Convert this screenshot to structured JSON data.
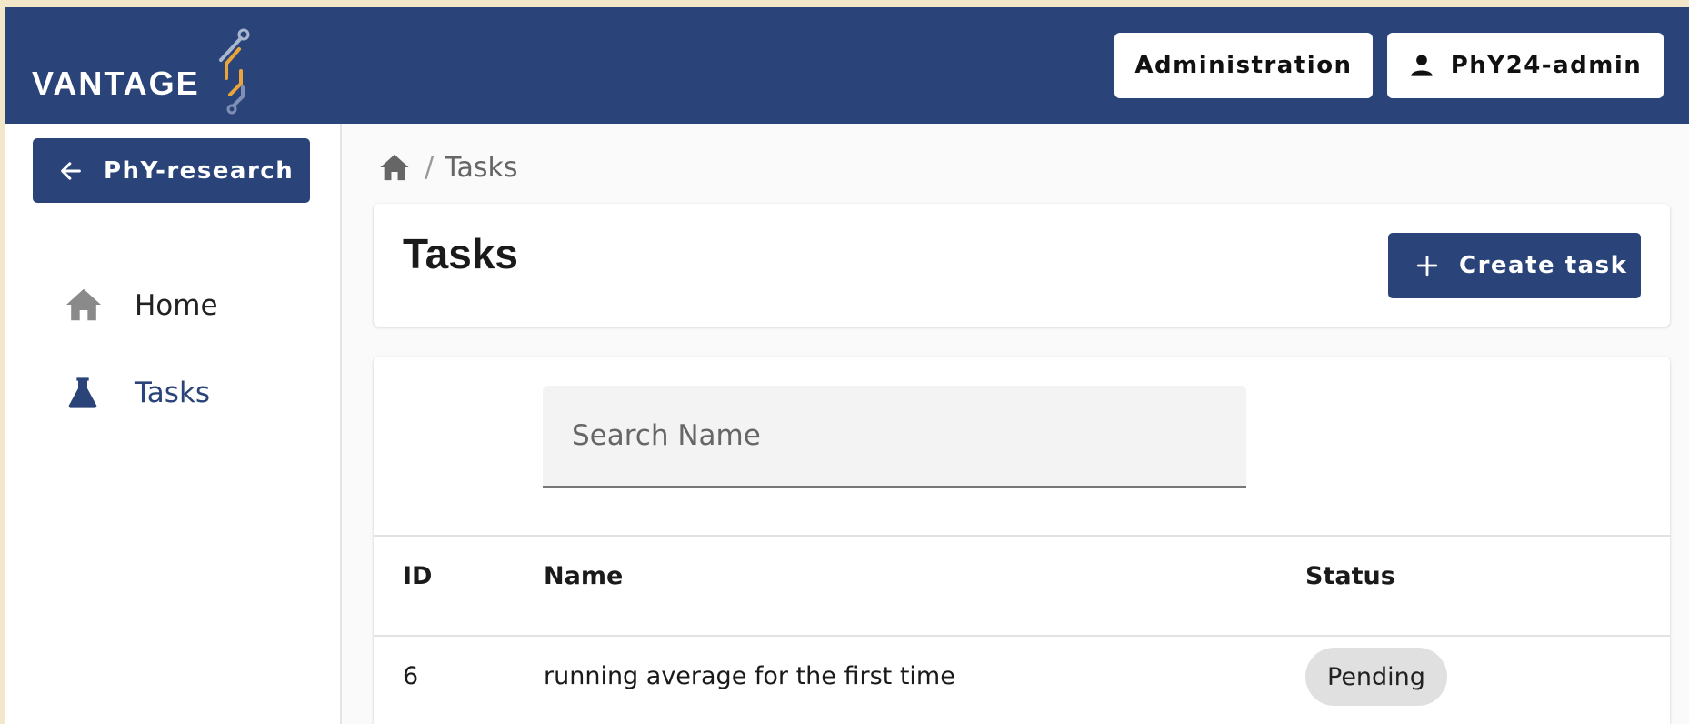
{
  "app": {
    "logo_text": "VANTAGE",
    "brand_color": "#2a4479",
    "accent_color": "#e9a53b"
  },
  "topbar": {
    "admin_label": "Administration",
    "user_label": "PhY24-admin",
    "user_icon": "person-icon"
  },
  "sidebar": {
    "back_label": "PhY-research",
    "back_icon": "arrow-left-icon",
    "items": [
      {
        "label": "Home",
        "icon": "home-icon",
        "active": false
      },
      {
        "label": "Tasks",
        "icon": "flask-icon",
        "active": true
      }
    ]
  },
  "breadcrumb": {
    "home_icon": "home-icon",
    "separator": "/",
    "current": "Tasks"
  },
  "main": {
    "title": "Tasks",
    "create_label": "Create task",
    "create_icon": "plus-icon",
    "search": {
      "placeholder": "Search Name",
      "value": ""
    },
    "table": {
      "columns": [
        "ID",
        "Name",
        "Status"
      ],
      "rows": [
        {
          "id": "6",
          "name": "running average for the first time",
          "status": "Pending"
        }
      ]
    }
  }
}
